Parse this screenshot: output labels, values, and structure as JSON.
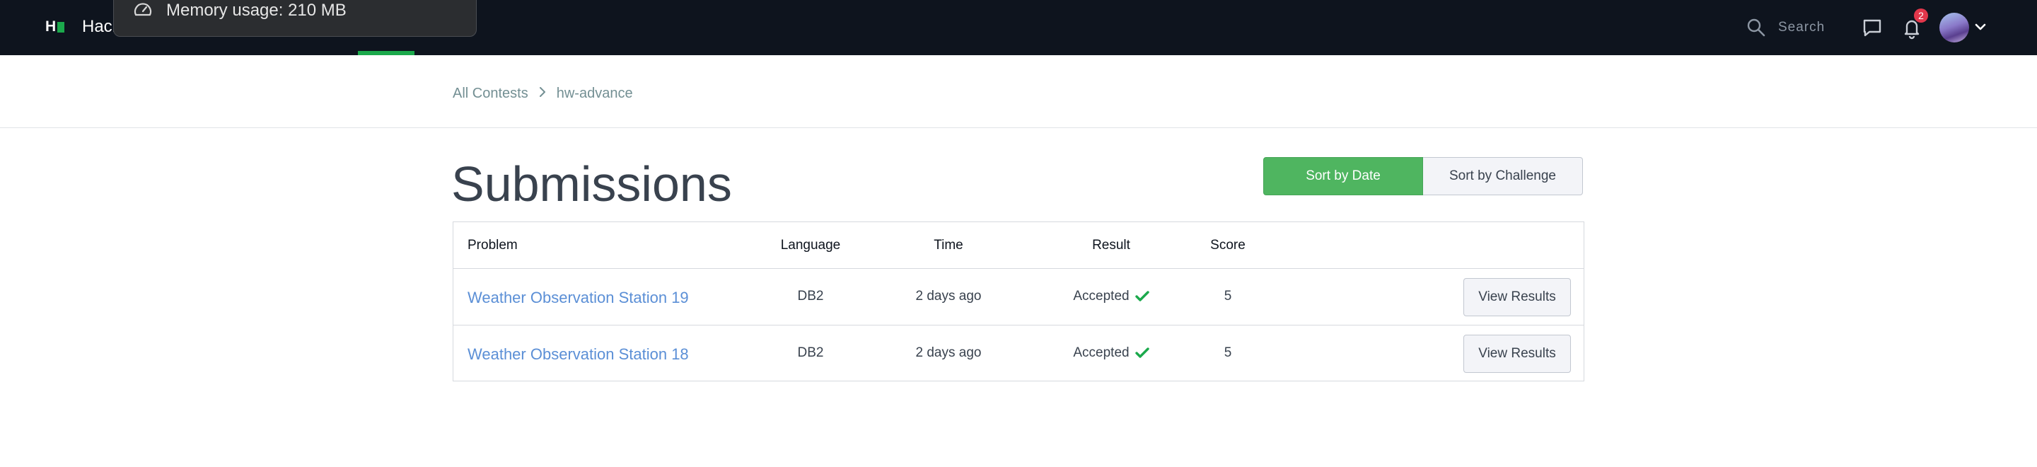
{
  "topbar": {
    "brand": "Hack",
    "search_placeholder": "Search",
    "notification_count": "2",
    "active_underline_color": "#1ba94c"
  },
  "overlay": {
    "memory_usage": "Memory usage: 210 MB"
  },
  "breadcrumb": {
    "items": [
      "All Contests",
      "hw-advance"
    ]
  },
  "page": {
    "title": "Submissions"
  },
  "sort": {
    "by_date": "Sort by Date",
    "by_challenge": "Sort by Challenge",
    "active": "Sort by Date",
    "active_color": "#4fb560"
  },
  "table": {
    "headers": [
      "Problem",
      "Language",
      "Time",
      "Result",
      "Score"
    ],
    "rows": [
      {
        "problem": "Weather Observation Station 19",
        "language": "DB2",
        "time": "2 days ago",
        "result": "Accepted",
        "score": "5",
        "action": "View Results"
      },
      {
        "problem": "Weather Observation Station 18",
        "language": "DB2",
        "time": "2 days ago",
        "result": "Accepted",
        "score": "5",
        "action": "View Results"
      }
    ],
    "accepted_color": "#1ba94c",
    "link_color": "#5b8fd6"
  },
  "icons": {
    "logo": "hackerrank-logo-icon",
    "search": "search-icon",
    "chat": "chat-icon",
    "bell": "bell-icon",
    "chevron": "chevron-down-icon",
    "breadcrumb_separator": "chevron-right-icon",
    "check": "checkmark-icon",
    "gauge": "gauge-icon"
  }
}
